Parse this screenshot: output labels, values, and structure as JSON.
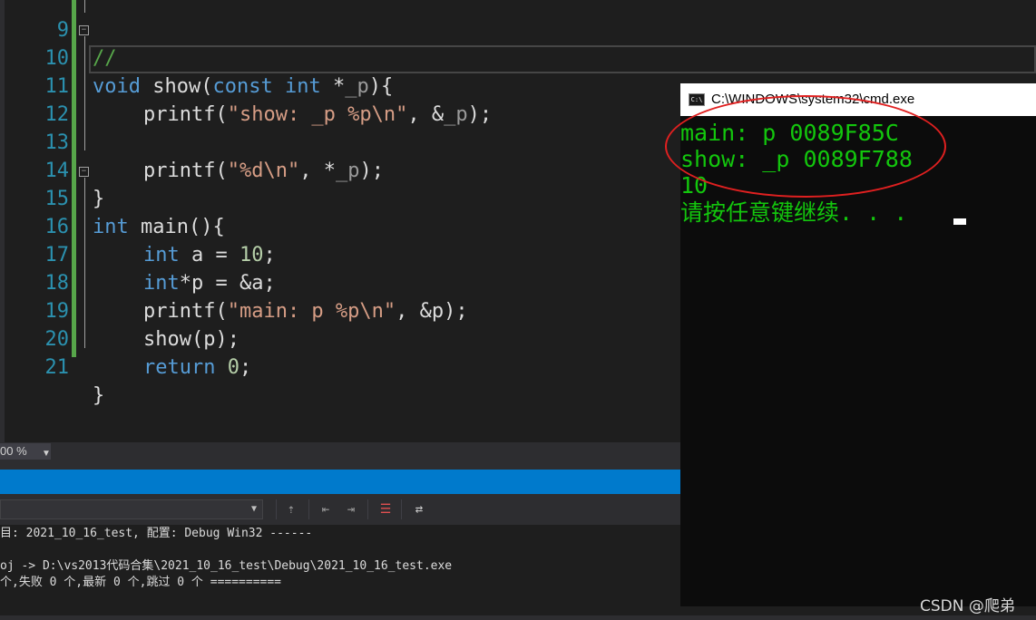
{
  "editor": {
    "lines": [
      {
        "num": "9",
        "text": "//"
      },
      {
        "num": "10",
        "text": "void show(const int *_p){"
      },
      {
        "num": "11",
        "text": "    printf(\"show: _p %p\\n\", &_p);"
      },
      {
        "num": "12",
        "text": ""
      },
      {
        "num": "13",
        "text": "    printf(\"%d\\n\", *_p);"
      },
      {
        "num": "14",
        "text": "}"
      },
      {
        "num": "15",
        "text": "int main(){"
      },
      {
        "num": "16",
        "text": "    int a = 10;"
      },
      {
        "num": "17",
        "text": "    int*p = &a;"
      },
      {
        "num": "18",
        "text": "    printf(\"main: p %p\\n\", &p);"
      },
      {
        "num": "19",
        "text": "    show(p);"
      },
      {
        "num": "20",
        "text": "    return 0;"
      },
      {
        "num": "21",
        "text": "}"
      }
    ],
    "tokens": {
      "l9": "//",
      "l10_kw1": "void",
      "l10_a": " show(",
      "l10_kw2": "const",
      "l10_sp": " ",
      "l10_kw3": "int",
      "l10_b": " *",
      "l10_p": "_p",
      "l10_c": "){",
      "l11_a": "printf(",
      "l11_str": "\"show: _p %p\\n\"",
      "l11_b": ", &",
      "l11_p": "_p",
      "l11_c": ");",
      "l13_a": "printf(",
      "l13_str": "\"%d\\n\"",
      "l13_b": ", *",
      "l13_p": "_p",
      "l13_c": ");",
      "l14": "}",
      "l15_kw": "int",
      "l15_a": " main(){",
      "l16_kw": "int",
      "l16_a": " a = ",
      "l16_num": "10",
      "l16_b": ";",
      "l17_kw": "int",
      "l17_a": "*p = &a;",
      "l18_a": "printf(",
      "l18_str": "\"main: p %p\\n\"",
      "l18_b": ", &p);",
      "l19": "show(p);",
      "l20_kw": "return",
      "l20_sp": " ",
      "l20_num": "0",
      "l20_b": ";",
      "l21": "}"
    },
    "zoom": "00 %",
    "fold_glyph": "−"
  },
  "output": {
    "lines": [
      "目: 2021_10_16_test, 配置: Debug Win32 ------",
      "",
      "oj -> D:\\vs2013代码合集\\2021_10_16_test\\Debug\\2021_10_16_test.exe",
      "个,失败 0 个,最新 0 个,跳过 0 个 =========="
    ]
  },
  "console": {
    "title": "C:\\WINDOWS\\system32\\cmd.exe",
    "icon_text": "C:\\",
    "lines": [
      "main: p 0089F85C",
      "show: _p 0089F788",
      "10",
      "请按任意键继续. . ."
    ]
  },
  "watermark": "CSDN @爬弟",
  "colors": {
    "editor_bg": "#1e1e1e",
    "keyword": "#569cd6",
    "string": "#d69d85",
    "number": "#b5cea8",
    "line_number": "#2b91af",
    "console_text": "#13c60d",
    "annotation_ellipse": "#e02020",
    "status_blue": "#007acc"
  },
  "icons": [
    "fold-minus-icon",
    "output-clear-icon",
    "word-wrap-icon",
    "cmd-window-icon"
  ]
}
